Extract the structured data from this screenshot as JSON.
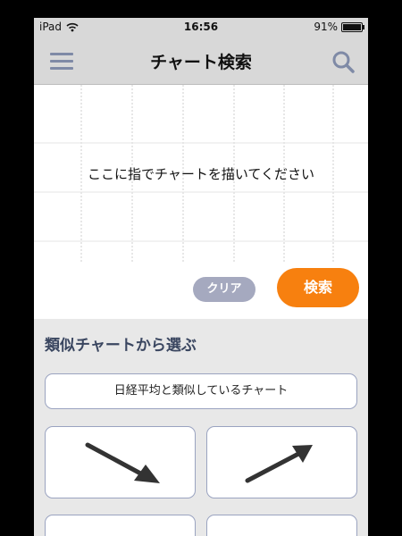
{
  "status_bar": {
    "device": "iPad",
    "time": "16:56",
    "battery_percent": "91%",
    "battery_level": 0.91
  },
  "nav": {
    "title": "チャート検索",
    "menu_icon": "hamburger-menu-icon",
    "search_icon": "search-icon"
  },
  "draw_area": {
    "hint": "ここに指でチャートを描いてください",
    "clear_label": "クリア",
    "search_label": "検索"
  },
  "similar": {
    "title": "類似チャートから選ぶ",
    "nikkei_label": "日経平均と類似しているチャート",
    "cards": [
      {
        "icon": "down-trend-arrow-icon"
      },
      {
        "icon": "up-trend-arrow-icon"
      }
    ]
  },
  "colors": {
    "accent_orange": "#f7800f",
    "clear_gray": "#a5a9bf",
    "section_title": "#3a4660",
    "border": "#9aa3c0"
  }
}
